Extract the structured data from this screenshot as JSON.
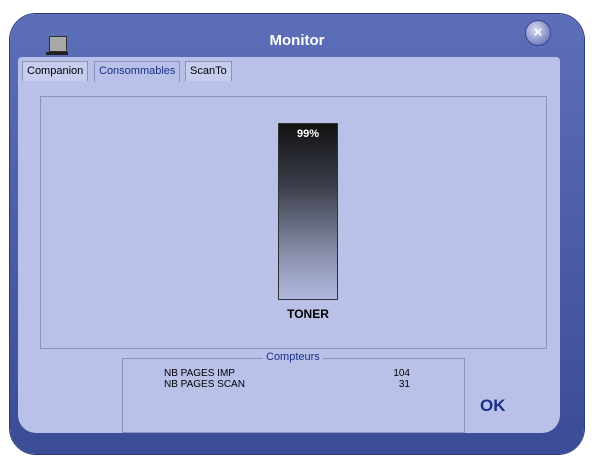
{
  "window": {
    "title": "Monitor"
  },
  "tabs": [
    {
      "label": "Companion"
    },
    {
      "label": "Consommables"
    },
    {
      "label": "ScanTo"
    }
  ],
  "active_tab": "Consommables",
  "toner": {
    "percent_label": "99%",
    "label": "TONER",
    "level_fraction": 0.99
  },
  "counters": {
    "legend": "Compteurs",
    "rows": [
      {
        "label": "NB PAGES IMP",
        "value": "104"
      },
      {
        "label": "NB PAGES SCAN",
        "value": "31"
      }
    ]
  },
  "buttons": {
    "ok_label": "OK",
    "close_glyph": "×"
  },
  "icons": {
    "app": "monitor-icon",
    "close": "close-icon"
  },
  "colors": {
    "frame": "#4a5ca8",
    "client": "#b9c1e8",
    "accent_text": "#1a2f8a"
  }
}
